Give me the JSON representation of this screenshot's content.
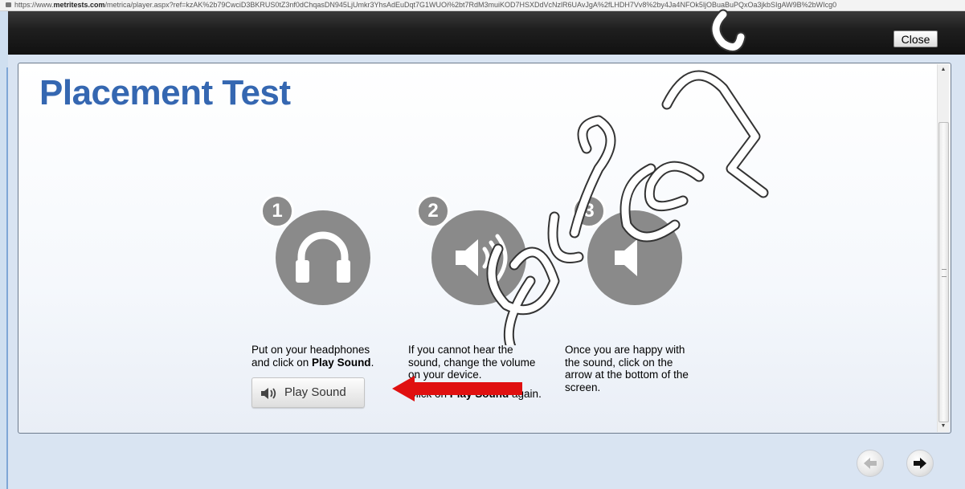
{
  "browser": {
    "url_prefix": "https://www.",
    "url_domain": "metritests.com",
    "url_rest": "/metrica/player.aspx?ref=kzAK%2b79CwciD3BKRUS0tZ3nf0dChqasDN945LjUmkr3YhsAdEuDqt7G1WUOi%2bt7RdM3muiKOD7HSXDdVcNzlR6UAvJgA%2fLHDH7Vv8%2by4Ja4NFOk5ljOBuaBuPQxOa3jkbSIgAW9B%2bWIcg0"
  },
  "topbar": {
    "close_label": "Close"
  },
  "page": {
    "title": "Placement Test"
  },
  "steps": [
    {
      "number": "1",
      "icon": "headphones-icon",
      "text_lines": [
        "Put on your headphones",
        "and click on "
      ],
      "text_bold": "Play Sound",
      "text_tail": "."
    },
    {
      "number": "2",
      "icon": "speaker-volume-icon",
      "line1": "If you cannot hear the",
      "line2": "sound, change the volume",
      "line3": "on your device.",
      "line4_pre": "Click on ",
      "line4_bold": "Play Sound",
      "line4_post": " again."
    },
    {
      "number": "3",
      "icon": "speaker-icon",
      "line1": "Once you are happy with",
      "line2": "the sound, click on the",
      "line3": "arrow at the bottom of the",
      "line4": "screen."
    }
  ],
  "play_button": {
    "label": "Play Sound",
    "icon": "speaker-sound-icon"
  },
  "nav": {
    "back_icon": "back-arrow-icon",
    "next_icon": "next-arrow-icon",
    "back_enabled": false,
    "next_enabled": true
  },
  "annotations": {
    "arrow_color": "#e01010",
    "watermark_color": "#ffffff"
  }
}
